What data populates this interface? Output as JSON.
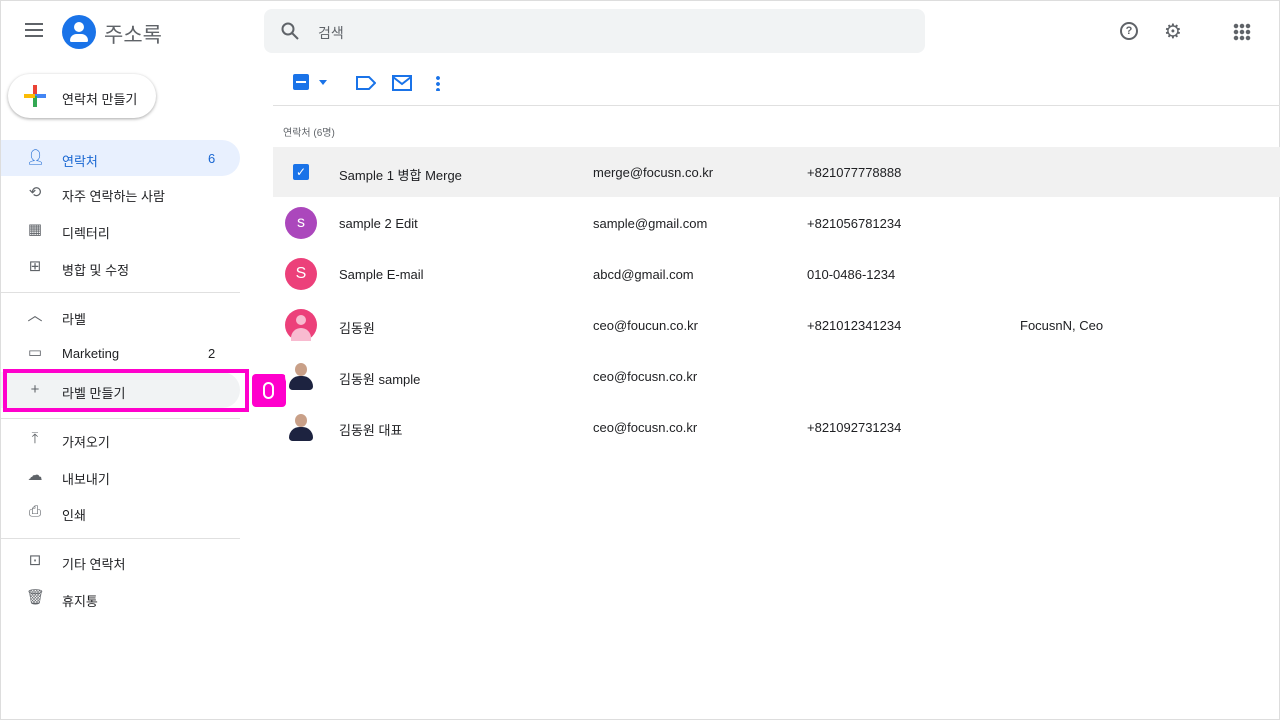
{
  "app": {
    "title": "주소록",
    "search_placeholder": "검색"
  },
  "create_label": "연락처 만들기",
  "nav": [
    {
      "label": "연락처",
      "count": "6"
    },
    {
      "label": "자주 연락하는 사람"
    },
    {
      "label": "디렉터리"
    },
    {
      "label": "병합 및 수정"
    }
  ],
  "labels": {
    "header": "라벨",
    "items": [
      {
        "label": "Marketing",
        "count": "2"
      }
    ],
    "create": "라벨 만들기"
  },
  "nav2": [
    {
      "label": "가져오기"
    },
    {
      "label": "내보내기"
    },
    {
      "label": "인쇄"
    }
  ],
  "nav3": [
    {
      "label": "기타 연락처"
    },
    {
      "label": "휴지통"
    }
  ],
  "list_header": "연락처 (6명)",
  "contacts": [
    {
      "initial": "",
      "name": "Sample 1 병합 Merge",
      "email": "merge@focusn.co.kr",
      "phone": "+821077778888",
      "company": ""
    },
    {
      "initial": "s",
      "name": "sample 2 Edit",
      "email": "sample@gmail.com",
      "phone": "+821056781234",
      "company": ""
    },
    {
      "initial": "S",
      "name": "Sample E-mail",
      "email": "abcd@gmail.com",
      "phone": "010-0486-1234",
      "company": ""
    },
    {
      "initial": "",
      "name": "김동원",
      "email": "ceo@foucun.co.kr",
      "phone": "+821012341234",
      "company": "FocusnN, Ceo"
    },
    {
      "initial": "",
      "name": "김동원 sample",
      "email": "ceo@focusn.co.kr",
      "phone": "",
      "company": ""
    },
    {
      "initial": "",
      "name": "김동원 대표",
      "email": "ceo@focusn.co.kr",
      "phone": "+821092731234",
      "company": ""
    }
  ],
  "colors": {
    "accent": "#1a73e8",
    "highlight": "#ff00cc"
  }
}
